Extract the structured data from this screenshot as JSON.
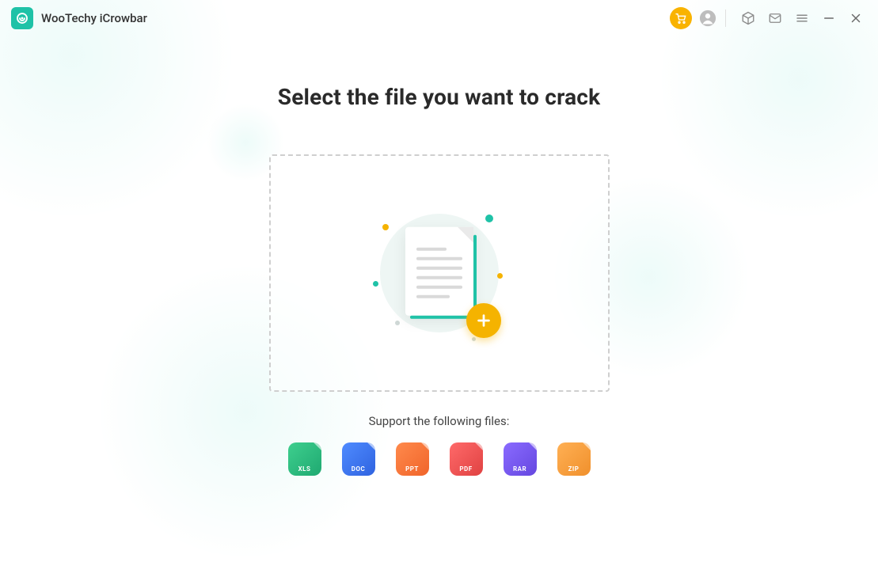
{
  "titlebar": {
    "app_name": "WooTechy iCrowbar"
  },
  "main": {
    "headline": "Select the file you want to crack",
    "support_label": "Support the following files:"
  },
  "filetypes": [
    {
      "label": "XLS"
    },
    {
      "label": "DOC"
    },
    {
      "label": "PPT"
    },
    {
      "label": "PDF"
    },
    {
      "label": "RAR"
    },
    {
      "label": "ZIP"
    }
  ]
}
